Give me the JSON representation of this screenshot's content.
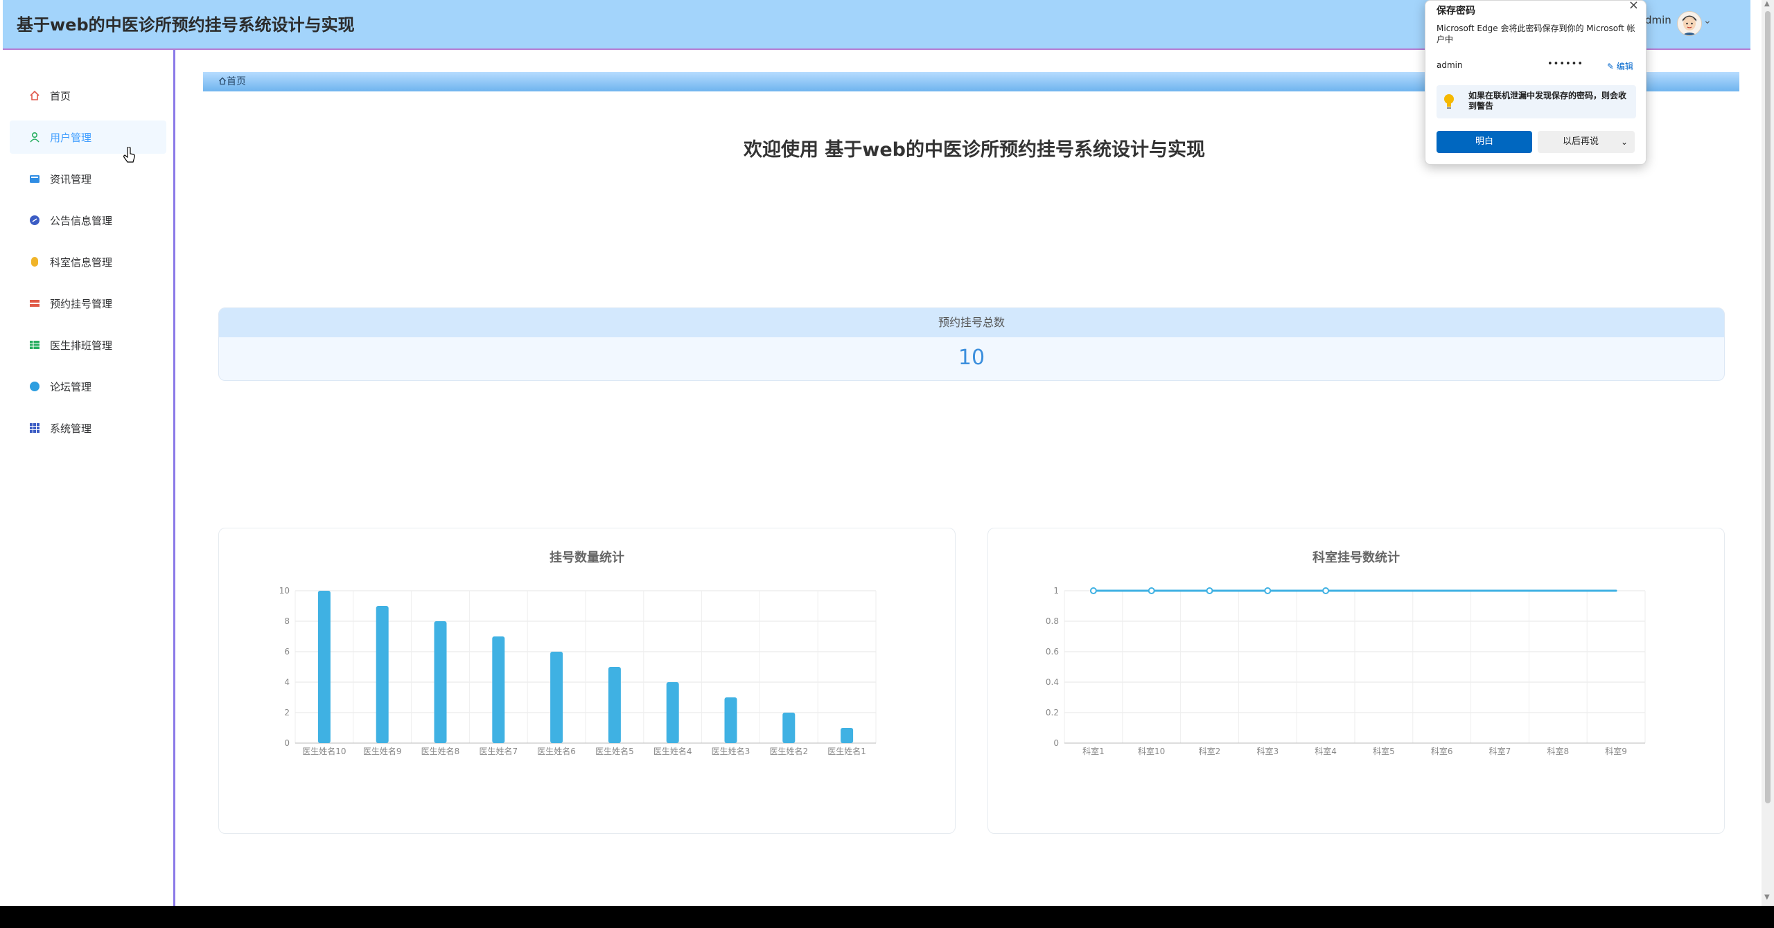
{
  "app": {
    "title": "基于web的中医诊所预约挂号系统设计与实现",
    "user": "dmin"
  },
  "sidebar": {
    "items": [
      {
        "label": "首页",
        "icon": "home-icon",
        "active": false
      },
      {
        "label": "用户管理",
        "icon": "user-icon",
        "active": true
      },
      {
        "label": "资讯管理",
        "icon": "news-icon",
        "active": false
      },
      {
        "label": "公告信息管理",
        "icon": "notice-icon",
        "active": false
      },
      {
        "label": "科室信息管理",
        "icon": "department-icon",
        "active": false
      },
      {
        "label": "预约挂号管理",
        "icon": "appointment-icon",
        "active": false
      },
      {
        "label": "医生排班管理",
        "icon": "schedule-icon",
        "active": false
      },
      {
        "label": "论坛管理",
        "icon": "forum-icon",
        "active": false
      },
      {
        "label": "系统管理",
        "icon": "grid-icon",
        "active": false
      }
    ]
  },
  "breadcrumb": {
    "home": "首页"
  },
  "main": {
    "welcome": "欢迎使用 基于web的中医诊所预约挂号系统设计与实现",
    "stat": {
      "label": "预约挂号总数",
      "value": "10"
    }
  },
  "charts": [
    {
      "title": "挂号数量统计"
    },
    {
      "title": "科室挂号数统计"
    }
  ],
  "chart_data": [
    {
      "type": "bar",
      "title": "挂号数量统计",
      "categories": [
        "医生姓名10",
        "医生姓名9",
        "医生姓名8",
        "医生姓名7",
        "医生姓名6",
        "医生姓名5",
        "医生姓名4",
        "医生姓名3",
        "医生姓名2",
        "医生姓名1"
      ],
      "values": [
        10,
        9,
        8,
        7,
        6,
        5,
        4,
        3,
        2,
        1
      ],
      "ylim": [
        0,
        10
      ],
      "yticks": [
        0,
        2,
        4,
        6,
        8,
        10
      ],
      "grid": true,
      "color": "#3fb1e3"
    },
    {
      "type": "line",
      "title": "科室挂号数统计",
      "categories": [
        "科室1",
        "科室10",
        "科室2",
        "科室3",
        "科室4",
        "科室5",
        "科室6",
        "科室7",
        "科室8",
        "科室9"
      ],
      "values": [
        1,
        1,
        1,
        1,
        1,
        1,
        1,
        1,
        1,
        1
      ],
      "ylim": [
        0,
        1
      ],
      "yticks": [
        0,
        0.2,
        0.4,
        0.6,
        0.8,
        1
      ],
      "grid": true,
      "color": "#3fb1e3"
    }
  ],
  "popup": {
    "title": "保存密码",
    "description": "Microsoft Edge 会将此密码保存到你的 Microsoft 帐户中",
    "username": "admin",
    "password_mask": "••••••",
    "edit": "编辑",
    "tip": "如果在联机泄漏中发现保存的密码，则会收到警告",
    "ok": "明白",
    "later": "以后再说"
  },
  "colors": {
    "header": "#a3d4fb",
    "accent": "#409eff",
    "bar": "#3fb1e3",
    "edge_button": "#0067c0"
  }
}
